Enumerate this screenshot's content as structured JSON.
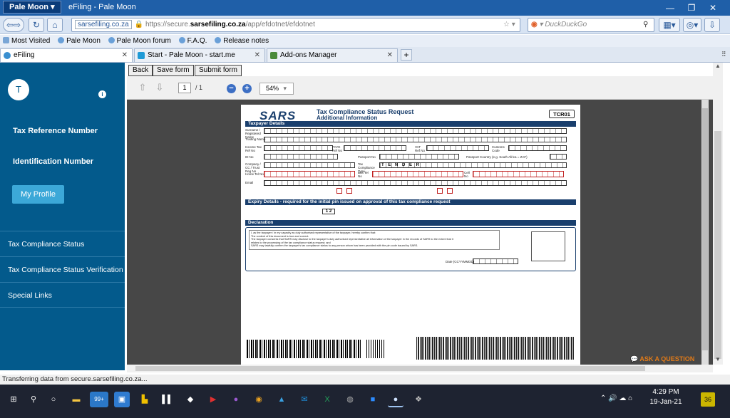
{
  "browser": {
    "app_menu": "Pale Moon",
    "window_title": "eFiling - Pale Moon",
    "url_domain_prefix": "https://secure.",
    "url_domain": "sarsefiling.co.za",
    "url_path": "/app/efdotnet/efdotnet",
    "url_short": "sarsefiling.co.za",
    "search_placeholder": "DuckDuckGo",
    "bookmarks": [
      "Most Visited",
      "Pale Moon",
      "Pale Moon forum",
      "F.A.Q.",
      "Release notes"
    ],
    "tabs": [
      "eFiling",
      "Start - Pale Moon - start.me",
      "Add-ons Manager"
    ],
    "status": "Transferring data from secure.sarsefiling.co.za..."
  },
  "sidebar": {
    "avatar_initial": "T",
    "tax_ref_label": "Tax Reference Number",
    "id_label": "Identification Number",
    "profile_button": "My Profile",
    "links": [
      "Tax Compliance Status",
      "Tax Compliance Status Verification",
      "Special Links"
    ]
  },
  "toolbar": {
    "back": "Back",
    "save": "Save form",
    "submit": "Submit form"
  },
  "pdf": {
    "page_current": "1",
    "page_total": "/ 1",
    "zoom": "54%"
  },
  "form": {
    "logo": "SARS",
    "title": "Tax Compliance Status Request",
    "subtitle": "Additional Information",
    "code": "TCR01",
    "section_taxpayer": "Taxpayer Details",
    "section_expiry": "Expiry Details - required for the initial pin issued on approval of this tax compliance request",
    "section_declaration": "Declaration",
    "company_type": "T E N D E R",
    "expiry_months": "1 2",
    "date_label": "Date (CCYYMMDD)",
    "labels": [
      "Surname / Registered Name",
      "Trading Name",
      "Income Tax Ref No",
      "PAYE Ref No",
      "VAT Ref No",
      "Customs Code",
      "ID No",
      "Passport No",
      "Passport Country (e.g. South Africa = ZAF)",
      "Company / CC / Trust Reg No",
      "Tax Compliance Type",
      "Home Tel No",
      "Bus Tel No",
      "Cell No",
      "Email"
    ],
    "declaration_lines": [
      "I, as the taxpayer / in my capacity as duly authorised representative of the taxpayer, hereby confirm that:",
      "The content of this document is true and correct.",
      "The taxpayer consents that SARS may disclose to the taxpayer's duly authorised representative all information of the taxpayer in the records of SARS to the extent that it",
      "relates to the processing of the tax compliance status request; and",
      "SARS may lawfully confirm the taxpayer's tax compliance status to any person whom has been provided with the pin code issued by SARS."
    ]
  },
  "chat": {
    "ask": "ASK A QUESTION"
  },
  "taskbar": {
    "time": "4:29 PM",
    "date": "19-Jan-21",
    "notifications": "36",
    "mail_badge": "99+"
  }
}
